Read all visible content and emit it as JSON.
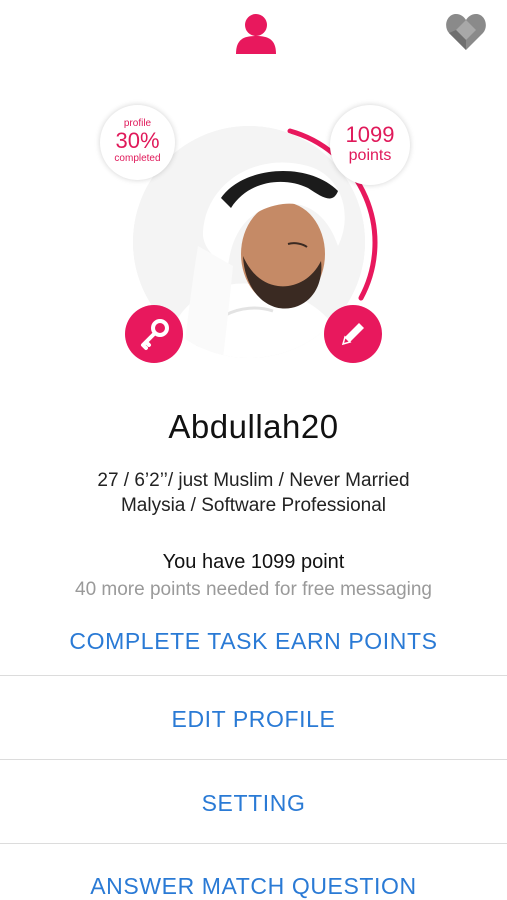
{
  "nav": {
    "profile_icon": "user-icon",
    "favorites_icon": "heart-icon"
  },
  "colors": {
    "accent": "#e8185d",
    "link": "#2a7ad5",
    "muted": "#9a9a9a"
  },
  "profile": {
    "completion_label": "profile",
    "completion_value": "30%",
    "completion_suffix": "completed",
    "completion_fraction": 0.3,
    "points_value": "1099",
    "points_label": "points",
    "username": "Abdullah20",
    "details_line1": "27 / 6’2’’/ just Muslim / Never Married",
    "details_line2": "Malysia / Software Professional",
    "points_statement": "You have 1099 point",
    "points_needed": "40 more points needed for free messaging"
  },
  "actions": {
    "key_icon": "key-icon",
    "edit_icon": "pencil-icon"
  },
  "menu": {
    "complete_tasks": "COMPLETE TASK EARN POINTS",
    "edit_profile": "EDIT PROFILE",
    "setting": "SETTING",
    "answer_match": "ANSWER MATCH QUESTION"
  }
}
